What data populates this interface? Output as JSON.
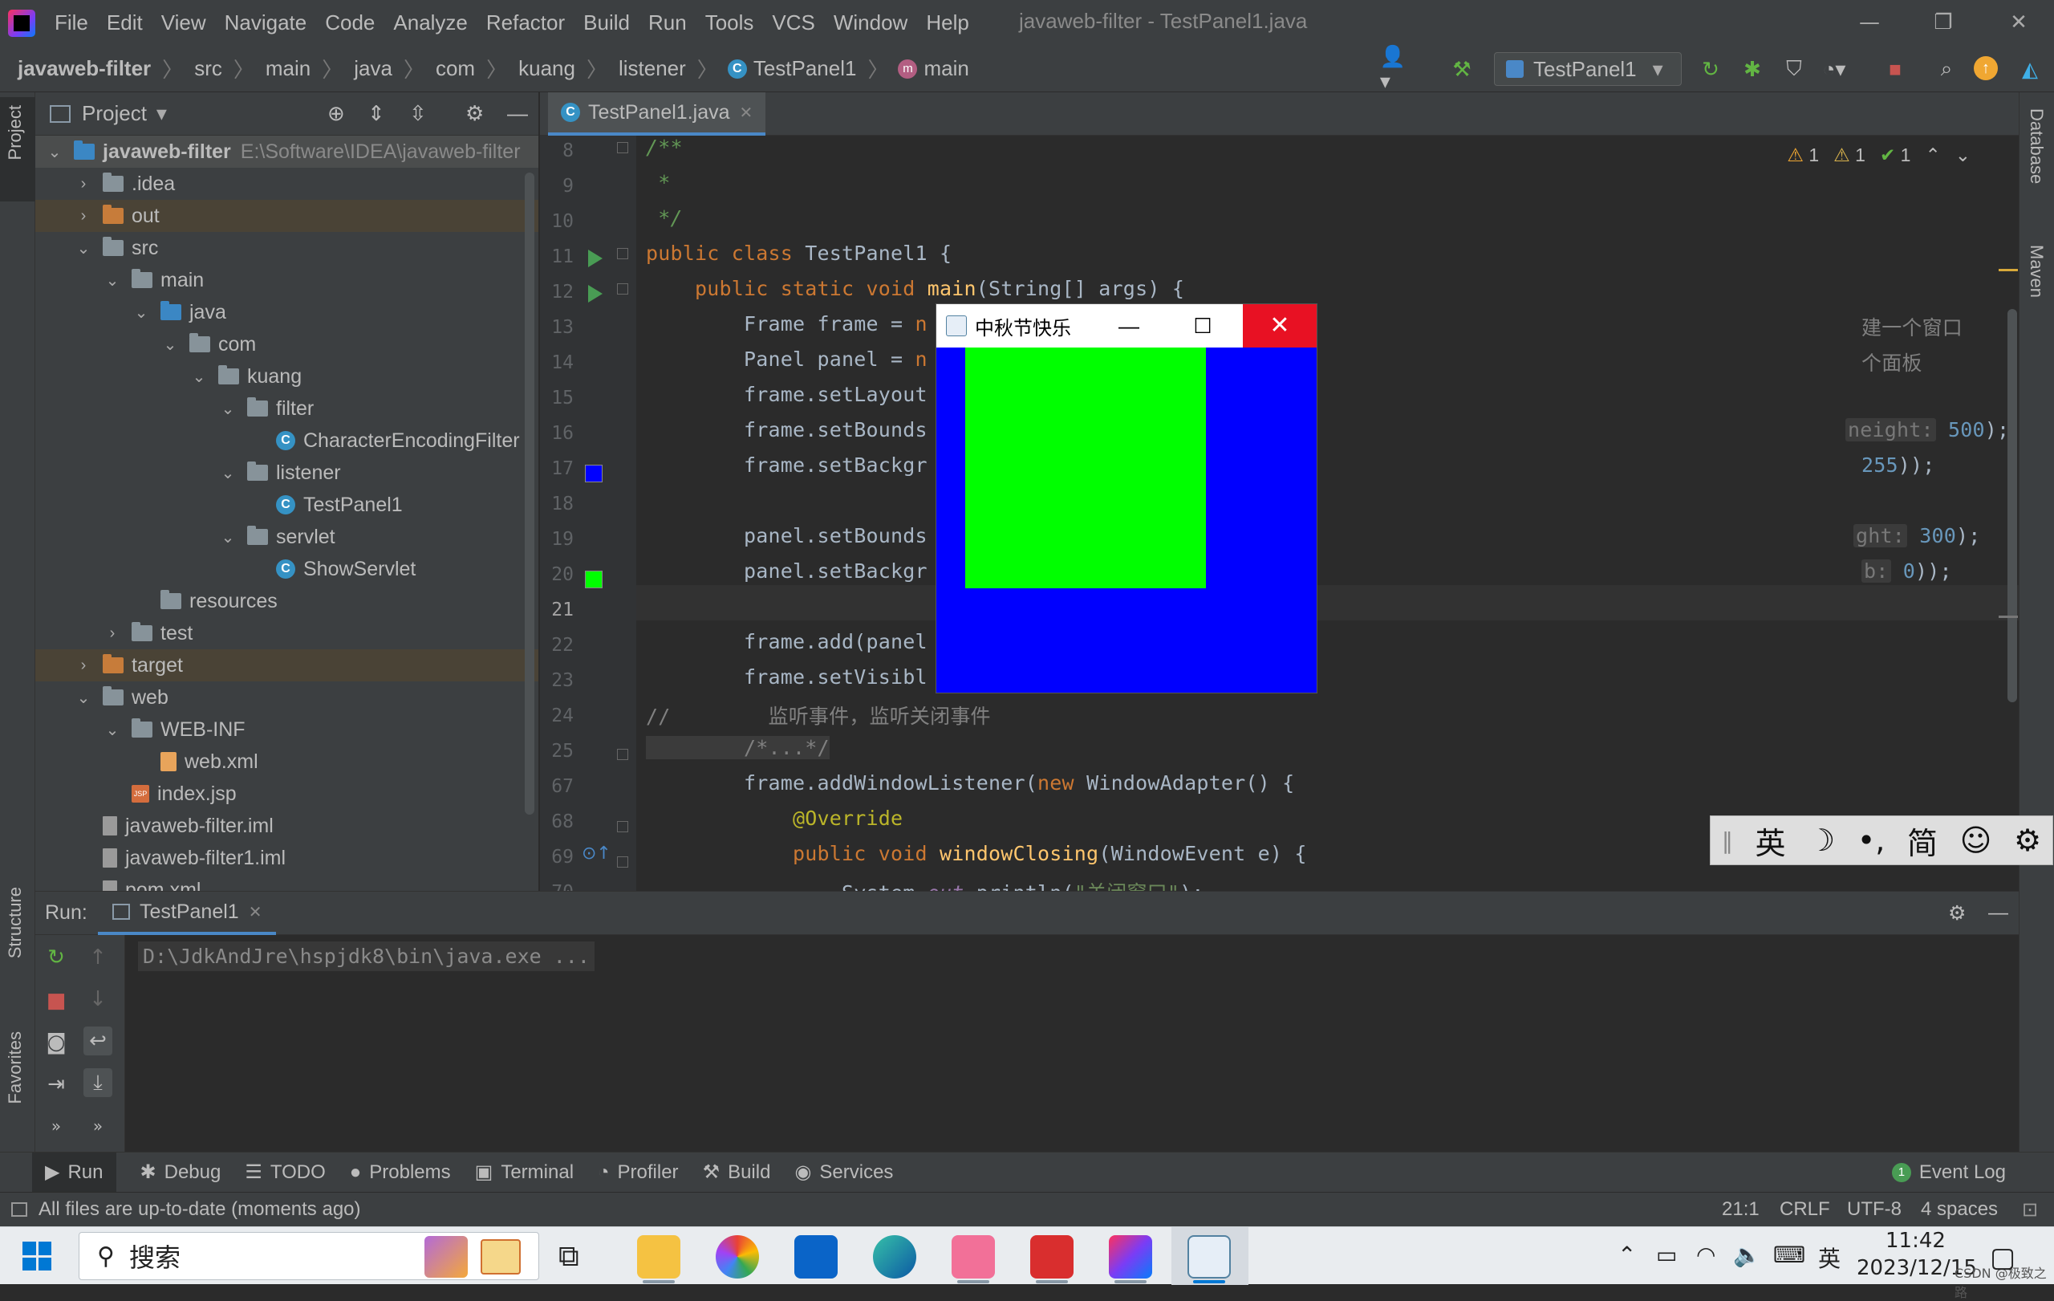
{
  "window": {
    "title": "javaweb-filter - TestPanel1.java",
    "min": "—",
    "restore": "❐",
    "close": "✕"
  },
  "menu": [
    "File",
    "Edit",
    "View",
    "Navigate",
    "Code",
    "Analyze",
    "Refactor",
    "Build",
    "Run",
    "Tools",
    "VCS",
    "Window",
    "Help"
  ],
  "breadcrumb": [
    "javaweb-filter",
    "src",
    "main",
    "java",
    "com",
    "kuang",
    "listener",
    "TestPanel1",
    "main"
  ],
  "run_config": "TestPanel1",
  "project_panel": {
    "title": "Project",
    "tree": [
      {
        "label": "javaweb-filter",
        "hint": "E:\\Software\\IDEA\\javaweb-filter",
        "level": 0,
        "chev": "v",
        "icon": "module",
        "bold": true,
        "sel": true
      },
      {
        "label": ".idea",
        "level": 1,
        "chev": ">",
        "icon": "folder"
      },
      {
        "label": "out",
        "level": 1,
        "chev": ">",
        "icon": "orange",
        "excl": true
      },
      {
        "label": "src",
        "level": 1,
        "chev": "v",
        "icon": "folder"
      },
      {
        "label": "main",
        "level": 2,
        "chev": "v",
        "icon": "folder"
      },
      {
        "label": "java",
        "level": 3,
        "chev": "v",
        "icon": "blue"
      },
      {
        "label": "com",
        "level": 4,
        "chev": "v",
        "icon": "folder"
      },
      {
        "label": "kuang",
        "level": 5,
        "chev": "v",
        "icon": "folder"
      },
      {
        "label": "filter",
        "level": 6,
        "chev": "v",
        "icon": "folder"
      },
      {
        "label": "CharacterEncodingFilter",
        "level": 7,
        "chev": "",
        "icon": "class"
      },
      {
        "label": "listener",
        "level": 6,
        "chev": "v",
        "icon": "folder"
      },
      {
        "label": "TestPanel1",
        "level": 7,
        "chev": "",
        "icon": "class"
      },
      {
        "label": "servlet",
        "level": 6,
        "chev": "v",
        "icon": "folder"
      },
      {
        "label": "ShowServlet",
        "level": 7,
        "chev": "",
        "icon": "class"
      },
      {
        "label": "resources",
        "level": 3,
        "chev": "",
        "icon": "folder"
      },
      {
        "label": "test",
        "level": 2,
        "chev": ">",
        "icon": "folder"
      },
      {
        "label": "target",
        "level": 1,
        "chev": ">",
        "icon": "orange",
        "excl": true
      },
      {
        "label": "web",
        "level": 1,
        "chev": "v",
        "icon": "folder"
      },
      {
        "label": "WEB-INF",
        "level": 2,
        "chev": "v",
        "icon": "folder"
      },
      {
        "label": "web.xml",
        "level": 3,
        "chev": "",
        "icon": "xml"
      },
      {
        "label": "index.jsp",
        "level": 2,
        "chev": "",
        "icon": "jsp"
      },
      {
        "label": "javaweb-filter.iml",
        "level": 1,
        "chev": "",
        "icon": "file"
      },
      {
        "label": "javaweb-filter1.iml",
        "level": 1,
        "chev": "",
        "icon": "file"
      },
      {
        "label": "pom.xml",
        "level": 1,
        "chev": "",
        "icon": "file"
      }
    ]
  },
  "editor": {
    "tab": "TestPanel1.java",
    "inspections": {
      "warn1": "1",
      "warn2": "1",
      "ok": "1"
    },
    "line_numbers": [
      "8",
      "9",
      "10",
      "11",
      "12",
      "13",
      "14",
      "15",
      "16",
      "17",
      "18",
      "19",
      "20",
      "21",
      "22",
      "23",
      "24",
      "25",
      "67",
      "68",
      "69",
      "70"
    ],
    "code": {
      "l8": "/**",
      "l9": " *",
      "l10": " */",
      "l11_kw": "public class ",
      "l11_rest": "TestPanel1 {",
      "l12_kw": "    public static void ",
      "l12_fn": "main",
      "l12_rest": "(String[] args) {",
      "l13": "        Frame frame = ",
      "l13_kw": "n",
      "l13_cm": "建一个窗口",
      "l14": "        Panel panel = ",
      "l14_kw": "n",
      "l14_cm": "个面板",
      "l15": "        frame.setLayout",
      "l16": "        frame.setBounds",
      "l16_hint": "neight:",
      "l16_num": "500",
      "l16_end": ");",
      "l17": "        frame.setBackgr",
      "l17_num": "255",
      "l17_end": "));",
      "l19": "        panel.setBounds",
      "l19_hint": "ght:",
      "l19_num": "300",
      "l19_end": ");",
      "l20": "        panel.setBackgr",
      "l20_hint": "b:",
      "l20_num": "0",
      "l20_end": "));",
      "l22": "        frame.add(panel",
      "l23": "        frame.setVisibl",
      "l24_slashes": "//",
      "l24_cm": "        监听事件，监听关闭事件",
      "l25": "        /*...*/",
      "l67_a": "        frame.addWindowListener(",
      "l67_kw": "new",
      "l67_b": " WindowAdapter() {",
      "l68": "            @Override",
      "l69_kw": "            public void ",
      "l69_fn": "windowClosing",
      "l69_rest": "(WindowEvent e) {",
      "l70_a": "                System.",
      "l70_st": "out",
      "l70_b": ".println(",
      "l70_str": "\"关闭窗口\"",
      "l70_c": ");"
    }
  },
  "popup_window": {
    "title": "中秋节快乐",
    "min": "—",
    "max": "☐",
    "close": "✕"
  },
  "ime": {
    "items": [
      "英",
      "☽",
      "•,",
      "简",
      "☺",
      "⚙"
    ]
  },
  "run_panel": {
    "label": "Run:",
    "tab": "TestPanel1",
    "console": "D:\\JdkAndJre\\hspjdk8\\bin\\java.exe ..."
  },
  "bottom_tabs": [
    "Run",
    "Debug",
    "TODO",
    "Problems",
    "Terminal",
    "Profiler",
    "Build",
    "Services"
  ],
  "event_log": "Event Log",
  "event_log_count": "1",
  "status": {
    "message": "All files are up-to-date (moments ago)",
    "position": "21:1",
    "line_sep": "CRLF",
    "encoding": "UTF-8",
    "indent": "4 spaces"
  },
  "taskbar": {
    "search": "搜索",
    "ime": "英",
    "time": "11:42",
    "date": "2023/12/15",
    "watermark": "CSDN @极致之路"
  },
  "side_labels": {
    "project": "Project",
    "structure": "Structure",
    "favorites": "Favorites",
    "database": "Database",
    "maven": "Maven"
  },
  "colors": {
    "ide_bg": "#2b2b2b",
    "panel_bg": "#3c3f41",
    "frame_bg": "#0000ff",
    "panel_green": "#00ff00",
    "close_red": "#e81123"
  }
}
